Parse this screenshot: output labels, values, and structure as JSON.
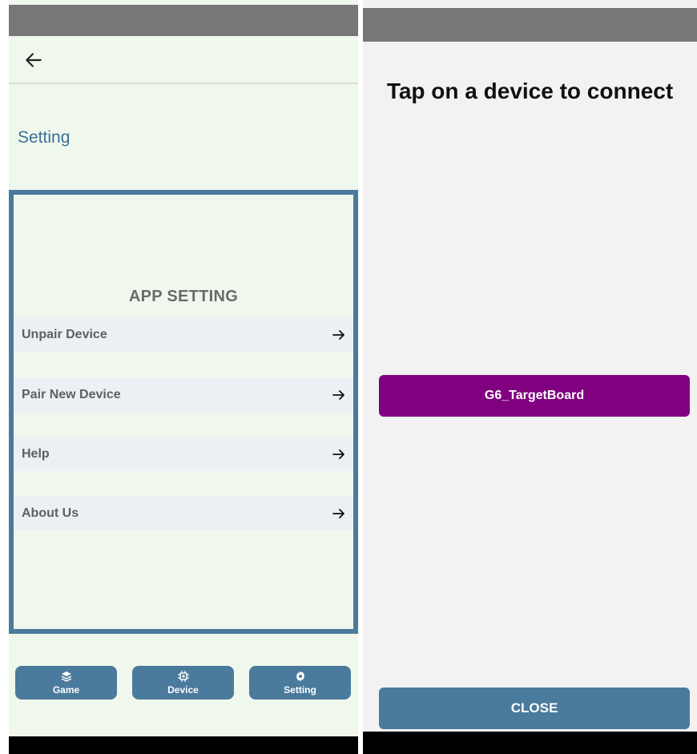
{
  "settings_screen": {
    "page_title": "Setting",
    "card": {
      "heading": "APP SETTING",
      "items": [
        {
          "label": "Unpair Device",
          "icon": "arrow-right-icon"
        },
        {
          "label": "Pair New Device",
          "icon": "arrow-right-icon"
        },
        {
          "label": "Help",
          "icon": "arrow-right-icon"
        },
        {
          "label": "About Us",
          "icon": "arrow-right-icon"
        }
      ]
    },
    "bottom_nav": [
      {
        "label": "Game",
        "icon": "layers-icon"
      },
      {
        "label": "Device",
        "icon": "chip-icon"
      },
      {
        "label": "Setting",
        "icon": "gear-icon"
      }
    ]
  },
  "connect_dialog": {
    "title": "Tap on a device to connect",
    "devices": [
      {
        "name": "G6_TargetBoard"
      }
    ],
    "close_label": "CLOSE"
  },
  "colors": {
    "accent_blue": "#4a7a9c",
    "device_purple": "#800080",
    "left_background": "#f0f8ee",
    "right_background": "#f2f2f2"
  }
}
